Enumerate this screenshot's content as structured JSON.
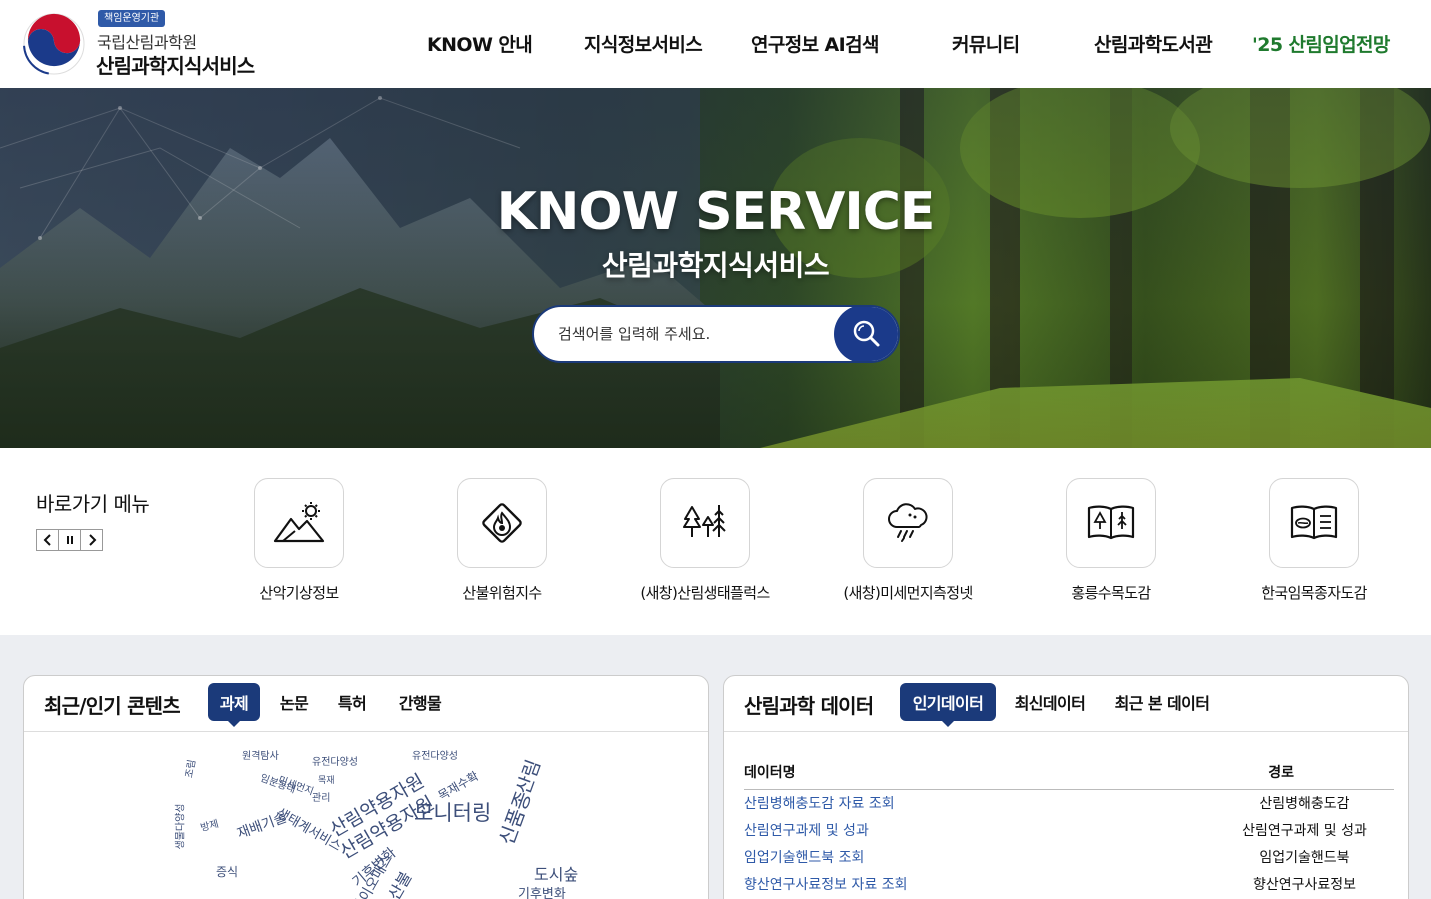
{
  "header": {
    "logo_badge": "책임운영기관",
    "logo_org": "국립산림과학원",
    "logo_name": "산림과학지식서비스",
    "nav": [
      {
        "label": "KNOW 안내"
      },
      {
        "label": "지식정보서비스"
      },
      {
        "label": "연구정보 AI검색"
      },
      {
        "label": "커뮤니티"
      },
      {
        "label": "산림과학도서관"
      },
      {
        "label": "'25 산림임업전망"
      }
    ]
  },
  "hero": {
    "title": "KNOW SERVICE",
    "subtitle": "산림과학지식서비스",
    "search_placeholder": "검색어를 입력해 주세요."
  },
  "quick_menu": {
    "title": "바로가기 메뉴",
    "items": [
      {
        "label": "산악기상정보",
        "icon": "mountain-sun-icon"
      },
      {
        "label": "산불위험지수",
        "icon": "fire-warning-icon"
      },
      {
        "label": "(새창)산림생태플럭스",
        "icon": "trees-icon"
      },
      {
        "label": "(새창)미세먼지측정넷",
        "icon": "cloud-rain-icon"
      },
      {
        "label": "홍릉수목도감",
        "icon": "tree-book-icon"
      },
      {
        "label": "한국임목종자도감",
        "icon": "seed-book-icon"
      }
    ]
  },
  "recent_popular": {
    "title": "최근/인기 콘텐츠",
    "tabs": [
      {
        "label": "과제",
        "active": true
      },
      {
        "label": "논문",
        "active": false
      },
      {
        "label": "특허",
        "active": false
      },
      {
        "label": "간행물",
        "active": false
      }
    ],
    "cloud_words": [
      "원격탐사",
      "유전다양성",
      "유전다양성",
      "산림약용자원",
      "산림약용자원",
      "모니터링",
      "산림",
      "신품종",
      "도시숲",
      "기후변화",
      "목재수확",
      "재배기술",
      "생태계서비스",
      "관리",
      "미세먼지",
      "증식",
      "방제",
      "산불",
      "바이오매스",
      "임분동태",
      "목재",
      "생물다양성",
      "조림",
      "기후변화"
    ]
  },
  "forest_data": {
    "title": "산림과학 데이터",
    "tabs": [
      {
        "label": "인기데이터",
        "active": true
      },
      {
        "label": "최신데이터",
        "active": false
      },
      {
        "label": "최근 본 데이터",
        "active": false
      }
    ],
    "columns": {
      "name": "데이터명",
      "path": "경로"
    },
    "rows": [
      {
        "name": "산림병해충도감 자료 조회",
        "path": "산림병해충도감"
      },
      {
        "name": "산림연구과제 및 성과",
        "path": "산림연구과제 및 성과"
      },
      {
        "name": "임업기술핸드북 조회",
        "path": "임업기술핸드북"
      },
      {
        "name": "향산연구사료정보 자료 조회",
        "path": "향산연구사료정보"
      }
    ]
  },
  "colors": {
    "primary_navy": "#1b3a7a",
    "accent_green": "#1f7a2e",
    "link_blue": "#2f5aa8"
  }
}
